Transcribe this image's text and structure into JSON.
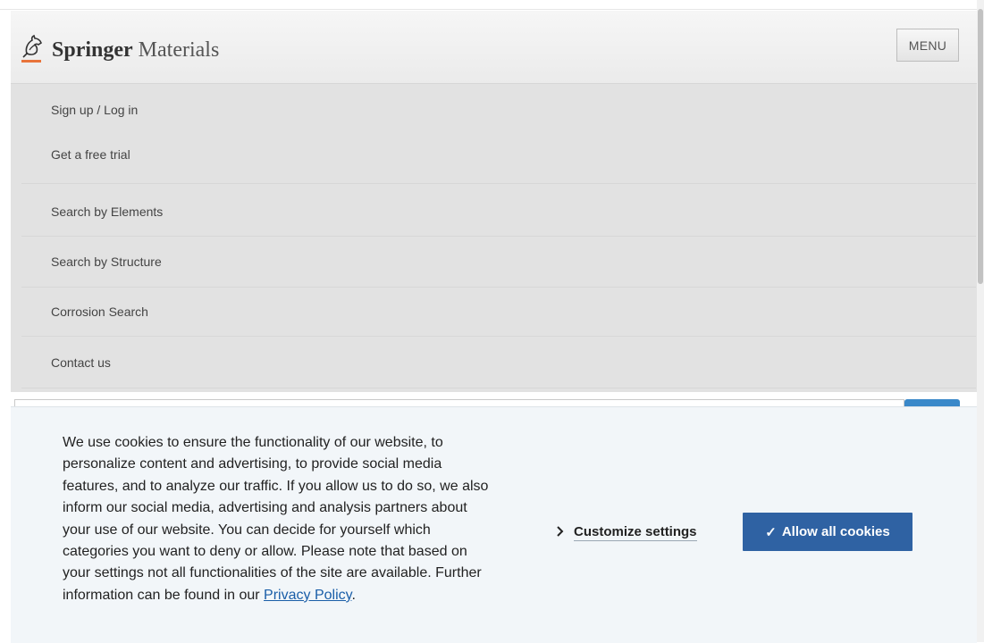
{
  "header": {
    "brand": "Springer",
    "product": "Materials",
    "menu_label": "MENU"
  },
  "menu": {
    "items": [
      {
        "label": "Sign up / Log in"
      },
      {
        "label": "Get a free trial"
      },
      {
        "label": "Search by Elements"
      },
      {
        "label": "Search by Structure"
      },
      {
        "label": "Corrosion Search"
      },
      {
        "label": "Contact us"
      }
    ]
  },
  "cookie": {
    "text": "We use cookies to ensure the functionality of our website, to personalize content and advertising, to provide social media features, and to analyze our traffic. If you allow us to do so, we also inform our social media, advertising and analysis partners about your use of our website. You can decide for yourself which categories you want to deny or allow. Please note that based on your settings not all functionalities of the site are available. Further information can be found in our",
    "privacy_link": "Privacy Policy",
    "period": ".",
    "customize_label": "Customize settings",
    "allow_label": "Allow all cookies",
    "check_glyph": "✓",
    "chevron_glyph": "›"
  },
  "colors": {
    "allow_button": "#2f62a3",
    "banner_bg": "#f2f6f9",
    "menu_bg": "#e2e2e2",
    "logo_accent": "#e8743b"
  }
}
